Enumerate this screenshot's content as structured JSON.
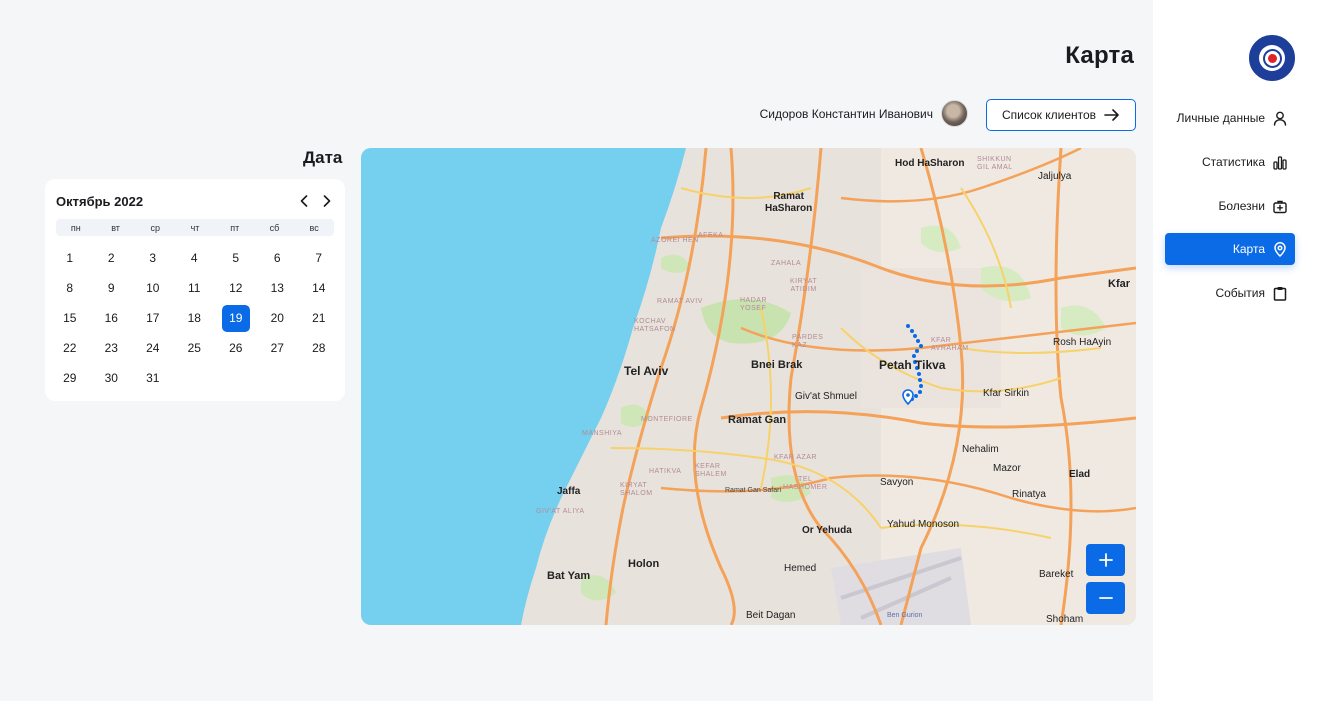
{
  "header": {
    "title": "Карта",
    "user_name": "Сидоров Константин Иванович",
    "clients_button": "Список клиентов"
  },
  "calendar": {
    "section_title": "Дата",
    "month": "Октябрь 2022",
    "weekdays": [
      "пн",
      "вт",
      "ср",
      "чт",
      "пт",
      "сб",
      "вс"
    ],
    "days": [
      "1",
      "2",
      "3",
      "4",
      "5",
      "6",
      "7",
      "8",
      "9",
      "10",
      "11",
      "12",
      "13",
      "14",
      "15",
      "16",
      "17",
      "18",
      "19",
      "20",
      "21",
      "22",
      "23",
      "24",
      "25",
      "26",
      "27",
      "28",
      "29",
      "30",
      "31"
    ],
    "selected_day": "19"
  },
  "map": {
    "labels": {
      "hod_hasharon": "Hod HaSharon",
      "ramat_hasharon": "Ramat\nHaSharon",
      "tel_aviv": "Tel Aviv",
      "bnei_brak": "Bnei Brak",
      "petah_tikva": "Petah Tikva",
      "givat_shmuel": "Giv'at Shmuel",
      "ramat_gan": "Ramat Gan",
      "kfar_sirkin": "Kfar Sirkin",
      "rosh_haayin": "Rosh HaAyin",
      "kfar": "Kfar",
      "jaljulya": "Jaljulya",
      "nehalim": "Nehalim",
      "mazor": "Mazor",
      "elad": "Elad",
      "rinatya": "Rinatya",
      "jaffa": "Jaffa",
      "savyon": "Savyon",
      "or_yehuda": "Or Yehuda",
      "yahud_monoson": "Yahud Monoson",
      "holon": "Holon",
      "bat_yam": "Bat Yam",
      "hemed": "Hemed",
      "bareket": "Bareket",
      "beit_dagan": "Beit Dagan",
      "shoham": "Shoham",
      "ben_gurion": "Ben Gurion",
      "ramat_gan_safari": "Ramat Gan Safari",
      "azorei_hen": "AZOREI HEN",
      "afeka": "AFEKA",
      "zahala": "ZAHALA",
      "kiryat_atidim": "KIRYAT\nATIDIM",
      "ramat_aviv": "RAMAT AVIV",
      "hadar_yosef": "HADAR\nYOSEF",
      "kochav_hatsafon": "KOCHAV\nHATSAFON",
      "pardes_kaz": "PARDES\nKAZ",
      "kfar_avraham": "KFAR\nAVRAHAM",
      "shikkun_gil_amal": "SHIKKUN\nGIL AMAL",
      "montefiore": "MONTEFIORE",
      "manshiya": "MANSHIYA",
      "kfar_azar": "KFAR AZAR",
      "hatikva": "HATIKVA",
      "kefar_shalem": "KEFAR\nSHALEM",
      "kiryat_shalom": "KIRYAT\nSHALOM",
      "tel_hashomer": "TEL\nHASHOMER",
      "givat_aliya": "GIV'AT ALIYA"
    },
    "zoom_in_icon": "plus-icon",
    "zoom_out_icon": "minus-icon"
  },
  "sidebar": {
    "items": [
      {
        "label": "Личные данные",
        "icon": "user-icon"
      },
      {
        "label": "Статистика",
        "icon": "bar-chart-icon"
      },
      {
        "label": "Болезни",
        "icon": "medical-kit-icon"
      },
      {
        "label": "Карта",
        "icon": "map-pin-icon",
        "active": true
      },
      {
        "label": "События",
        "icon": "clipboard-icon"
      }
    ]
  },
  "colors": {
    "accent": "#0b6be6",
    "sea": "#75cfef",
    "land": "#efe9e1",
    "road_major": "#f4a259",
    "road_minor": "#f7d26a",
    "park": "#c8e3b0"
  }
}
